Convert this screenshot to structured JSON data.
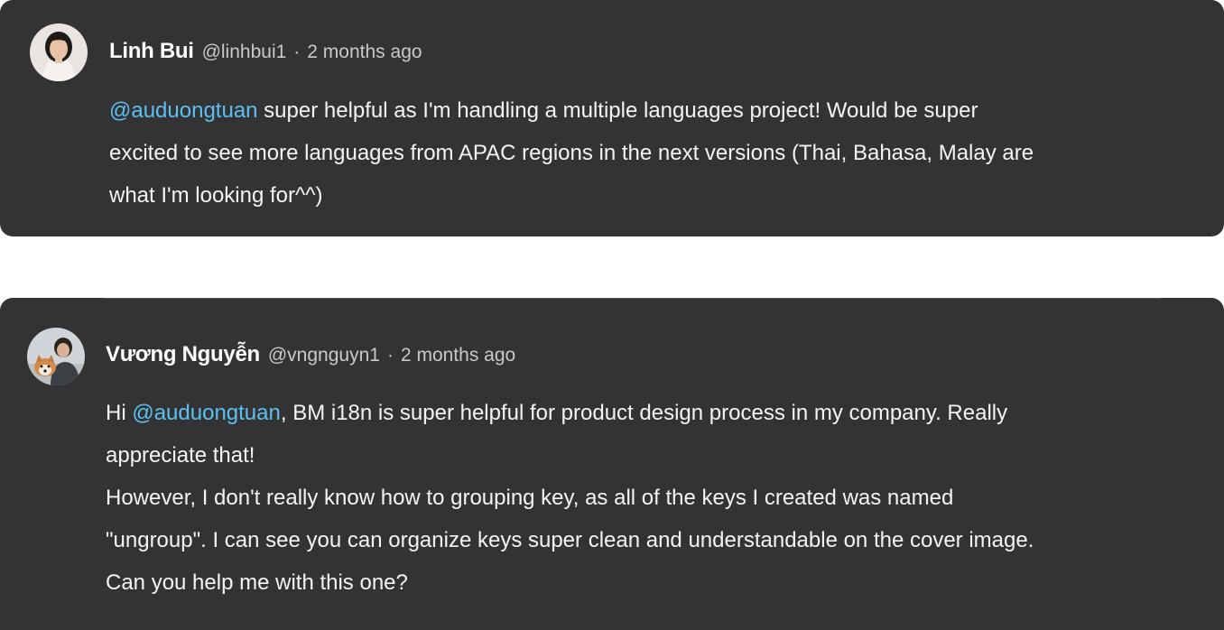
{
  "comments": [
    {
      "author": "Linh Bui",
      "handle": "@linhbui1",
      "separator": "·",
      "time": "2 months ago",
      "body": {
        "line1_mention": "@auduongtuan",
        "line1_rest": " super helpful as I'm handling a multiple languages project! Would be super",
        "line2": "excited to see more languages from APAC regions in the next versions (Thai, Bahasa, Malay are",
        "line3": "what I'm looking for^^)"
      }
    },
    {
      "author": "Vương Nguyễn",
      "handle": "@vngnguyn1",
      "separator": "·",
      "time": "2 months ago",
      "body": {
        "line1_prefix": "Hi ",
        "line1_mention": "@auduongtuan",
        "line1_rest": ", BM i18n is super helpful for product design process in my company. Really",
        "line2": "appreciate that!",
        "line3": "However, I don't really know how to grouping key, as all of the keys I created was named",
        "line4": "\"ungroup\". I can see you can organize keys super clean and understandable on the cover image.",
        "line5": "Can you help me with this one?"
      }
    }
  ],
  "colors": {
    "card_background": "#333333",
    "mention": "#5cc0f2",
    "text": "#f4f4f4",
    "muted": "#c9c9c9"
  },
  "icons": {
    "avatar_1": "user-avatar-photo",
    "avatar_2": "user-avatar-photo-with-dog"
  }
}
